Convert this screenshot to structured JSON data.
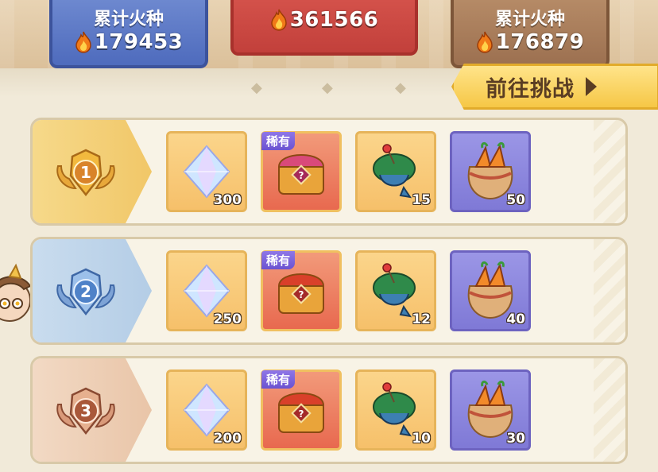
{
  "score_cards": {
    "left": {
      "title": "累计火种",
      "value": "179453"
    },
    "center": {
      "value": "361566"
    },
    "right": {
      "title": "累计火种",
      "value": "176879"
    }
  },
  "go_button": {
    "label": "前往挑战"
  },
  "rewards": [
    {
      "rank": "1",
      "items": [
        {
          "name": "crystal",
          "qty": "300"
        },
        {
          "name": "rare-chest",
          "tag": "稀有"
        },
        {
          "name": "spinning-top",
          "qty": "15"
        },
        {
          "name": "carrot-bag",
          "qty": "50"
        }
      ]
    },
    {
      "rank": "2",
      "items": [
        {
          "name": "crystal",
          "qty": "250"
        },
        {
          "name": "rare-chest",
          "tag": "稀有"
        },
        {
          "name": "spinning-top",
          "qty": "12"
        },
        {
          "name": "carrot-bag",
          "qty": "40"
        }
      ]
    },
    {
      "rank": "3",
      "items": [
        {
          "name": "crystal",
          "qty": "200"
        },
        {
          "name": "rare-chest",
          "tag": "稀有"
        },
        {
          "name": "spinning-top",
          "qty": "10"
        },
        {
          "name": "carrot-bag",
          "qty": "30"
        }
      ]
    }
  ],
  "colors": {
    "rank1": "#f1c768",
    "rank2": "#b4cde6",
    "rank3": "#e9c5a8",
    "gold_slot": "#f6c06a",
    "purple_slot": "#7f79d6"
  }
}
